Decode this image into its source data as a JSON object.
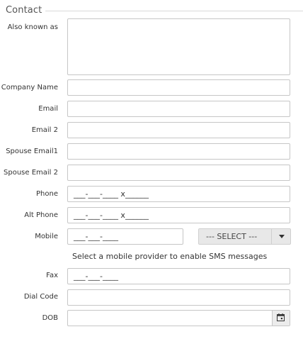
{
  "section": {
    "title": "Contact"
  },
  "fields": {
    "also_known_as": {
      "label": "Also known as",
      "value": ""
    },
    "company_name": {
      "label": "Company Name",
      "value": ""
    },
    "email": {
      "label": "Email",
      "value": ""
    },
    "email2": {
      "label": "Email 2",
      "value": ""
    },
    "spouse_email1": {
      "label": "Spouse Email1",
      "value": ""
    },
    "spouse_email2": {
      "label": "Spouse Email 2",
      "value": ""
    },
    "phone": {
      "label": "Phone",
      "mask": "___-___-____ x______"
    },
    "alt_phone": {
      "label": "Alt Phone",
      "mask": "___-___-____ x______"
    },
    "mobile": {
      "label": "Mobile",
      "mask": "___-___-____"
    },
    "mobile_provider": {
      "selected": "--- SELECT ---"
    },
    "fax": {
      "label": "Fax",
      "mask": "___-___-____"
    },
    "dial_code": {
      "label": "Dial Code",
      "value": ""
    },
    "dob": {
      "label": "DOB",
      "value": ""
    }
  },
  "hint": "Select a mobile provider to enable SMS messages",
  "icons": {
    "provider_dropdown": "chevron-down-icon",
    "dob_picker": "calendar-icon"
  }
}
